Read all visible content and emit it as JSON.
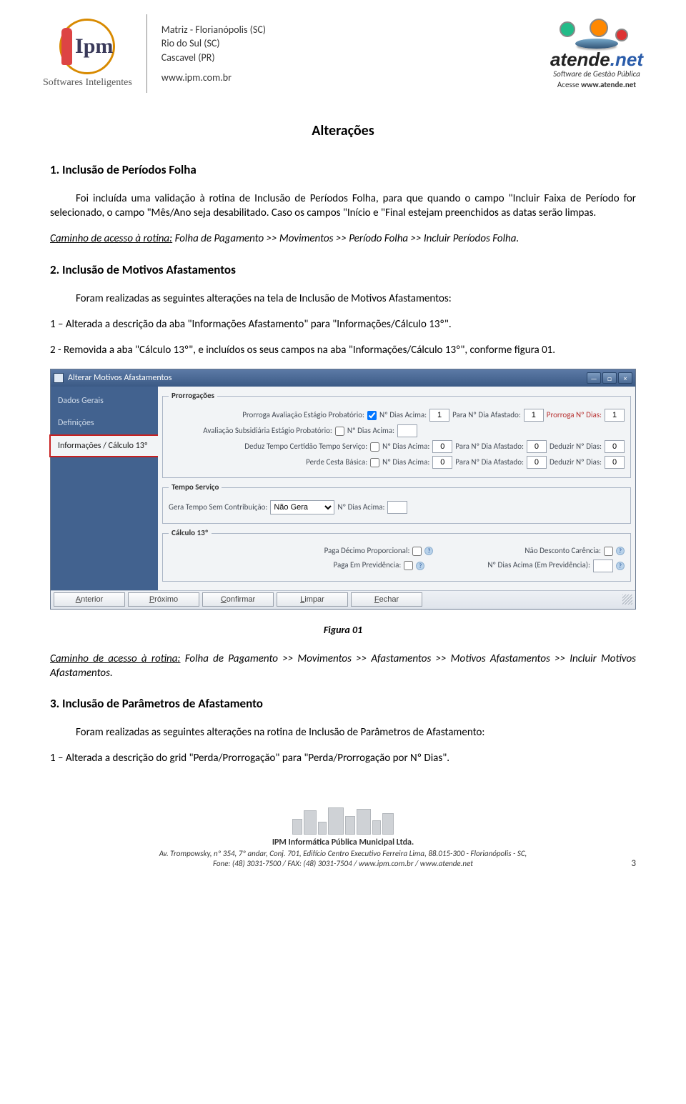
{
  "header": {
    "ipm_text": "Ipm",
    "ipm_tagline": "Softwares Inteligentes",
    "matriz_l1": "Matriz - Florianópolis (SC)",
    "matriz_l2": "Rio do Sul (SC)",
    "matriz_l3": "Cascavel (PR)",
    "matriz_site": "www.ipm.com.br",
    "atende_brand": "atende",
    "atende_dotnet": ".net",
    "atende_sub": "Software de Gestão Pública",
    "atende_acesse_prefix": "Acesse ",
    "atende_acesse_bold": "www.atende.net"
  },
  "title": "Alterações",
  "sec1": {
    "heading": "1. Inclusão de Períodos Folha",
    "para": "Foi incluída uma validação à rotina de Inclusão de Períodos Folha, para que quando o campo \"Incluir Faixa de Período for selecionado, o campo \"Mês/Ano seja desabilitado. Caso os campos \"Início e \"Final estejam preenchidos as datas serão limpas.",
    "caminho_label": "Caminho de acesso à rotina:",
    "caminho_text": " Folha de Pagamento >> Movimentos >> Período Folha >> Incluir Períodos Folha."
  },
  "sec2": {
    "heading": "2. Inclusão de Motivos Afastamentos",
    "intro": "Foram realizadas as seguintes alterações na tela de Inclusão de Motivos Afastamentos:",
    "item1": "1 – Alterada a descrição da aba \"Informações Afastamento\" para \"Informações/Cálculo 13º\".",
    "item2": "2 - Removida a aba \"Cálculo 13º\", e incluídos os seus campos na aba \"Informações/Cálculo 13º\", conforme figura 01."
  },
  "app": {
    "title": "Alterar Motivos Afastamentos",
    "nav": {
      "dados": "Dados Gerais",
      "def": "Definições",
      "info": "Informações / Cálculo 13º"
    },
    "fs_prorrog": "Prorrogações",
    "row1": {
      "lbl1": "Prorroga Avaliação Estágio Probatório:",
      "lbl2": "Nº Dias Acima:",
      "v2": "1",
      "lbl3": "Para Nº Dia Afastado:",
      "v3": "1",
      "lbl4": "Prorroga Nº Dias:",
      "v4": "1"
    },
    "row2": {
      "lbl1": "Avaliação Subsidiária Estágio Probatório:",
      "lbl2": "Nº Dias Acima:",
      "v2": ""
    },
    "row3": {
      "lbl1": "Deduz Tempo Certidão Tempo Serviço:",
      "lbl2": "Nº Dias Acima:",
      "v2": "0",
      "lbl3": "Para Nº Dia Afastado:",
      "v3": "0",
      "lbl4": "Deduzir Nº Dias:",
      "v4": "0"
    },
    "row4": {
      "lbl1": "Perde Cesta Básica:",
      "lbl2": "Nº Dias Acima:",
      "v2": "0",
      "lbl3": "Para Nº Dia Afastado:",
      "v3": "0",
      "lbl4": "Deduzir Nº Dias:",
      "v4": "0"
    },
    "fs_tempo": "Tempo Serviço",
    "row5": {
      "lbl1": "Gera Tempo Sem Contribuição:",
      "sel": "Não Gera",
      "lbl2": "Nº Dias Acima:",
      "v2": ""
    },
    "fs_calc": "Cálculo 13º",
    "row6": {
      "lbl1": "Paga Décimo Proporcional:",
      "lbl2": "Não Desconto Carência:"
    },
    "row7": {
      "lbl1": "Paga Em Previdência:",
      "lbl2": "Nº Dias Acima (Em Previdência):",
      "v2": ""
    },
    "btns": {
      "anterior": "Anterior",
      "proximo": "Próximo",
      "confirmar": "Confirmar",
      "limpar": "Limpar",
      "fechar": "Fechar"
    }
  },
  "fig_caption": "Figura 01",
  "sec2_caminho": {
    "label": "Caminho de acesso à rotina:",
    "text": " Folha de Pagamento >> Movimentos >> Afastamentos >> Motivos Afastamentos >> Incluir Motivos Afastamentos."
  },
  "sec3": {
    "heading": "3. Inclusão de Parâmetros de Afastamento",
    "intro": "Foram realizadas as seguintes alterações na rotina de Inclusão de Parâmetros de Afastamento:",
    "item1": "1 – Alterada a descrição do grid \"Perda/Prorrogação\" para \"Perda/Prorrogação por Nº Dias\"."
  },
  "footer": {
    "company": "IPM Informática Pública Municipal Ltda.",
    "addr1": "Av. Trompowsky, nº 354, 7º andar, Conj. 701, Edifício Centro Executivo Ferreira Lima, 88.015-300 - Florianópolis - SC,",
    "addr2": "Fone: (48) 3031-7500 / FAX: (48) 3031-7504 / www.ipm.com.br / www.atende.net",
    "page": "3"
  }
}
